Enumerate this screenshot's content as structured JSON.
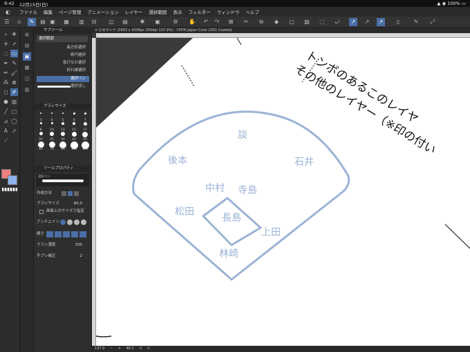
{
  "status": {
    "time": "9:42",
    "date": "12月15日(日)",
    "battery": "100%"
  },
  "menu": [
    "ファイル",
    "編集",
    "ページ管理",
    "アニメーション",
    "レイヤー",
    "選択範囲",
    "表示",
    "フィルター",
    "ウィンドウ",
    "ヘルプ"
  ],
  "panel": {
    "subtool_title": "サブツール",
    "group_label": "選択範囲",
    "subtools": [
      "長方形選択",
      "楕円選択",
      "投げなわ選択",
      "折れ線選択",
      "選択ペン",
      "選択消し"
    ],
    "brushsize_title": "ブラシサイズ",
    "brush_sizes": [
      "3",
      "4",
      "5",
      "6",
      "7",
      "8",
      "10",
      "12",
      "15",
      "17",
      "20",
      "25",
      "30",
      "40",
      "50",
      "60",
      "70",
      "80",
      "100",
      "120"
    ],
    "toolprop_title": "ツールプロパティ",
    "preview_label": "選択ペン",
    "mode_label": "作成方法",
    "brushsize_label": "ブラシサイズ",
    "brushsize_value": "80.0",
    "screen_size_label": "画面上のサイズで指定",
    "antialias_label": "アンチエイリ",
    "hardness_label": "硬さ",
    "density_label": "ブラシ濃度",
    "density_value": "100",
    "stabilization_label": "手ブレ補正",
    "stabilization_value": "2"
  },
  "canvas": {
    "tab_title": "ひるサンテ (2963 x 4336px 350dpi 137.9%) - CMYK Japan Color 2001 Coated)",
    "zoom": "137.9",
    "angle": "46.1",
    "overlay_line1": "トンボのあるこのレイヤ",
    "overlay_line2": "その他のレイヤー（※印の付い",
    "positions": {
      "center_field": "談",
      "left_field": "後本",
      "right_field": "石井",
      "short_stop": "中村",
      "second_base": "寺島",
      "third_base": "松田",
      "first_base": "上田",
      "pitcher": "長島",
      "catcher": "林崎"
    },
    "field_color": "#9bb3d6"
  }
}
